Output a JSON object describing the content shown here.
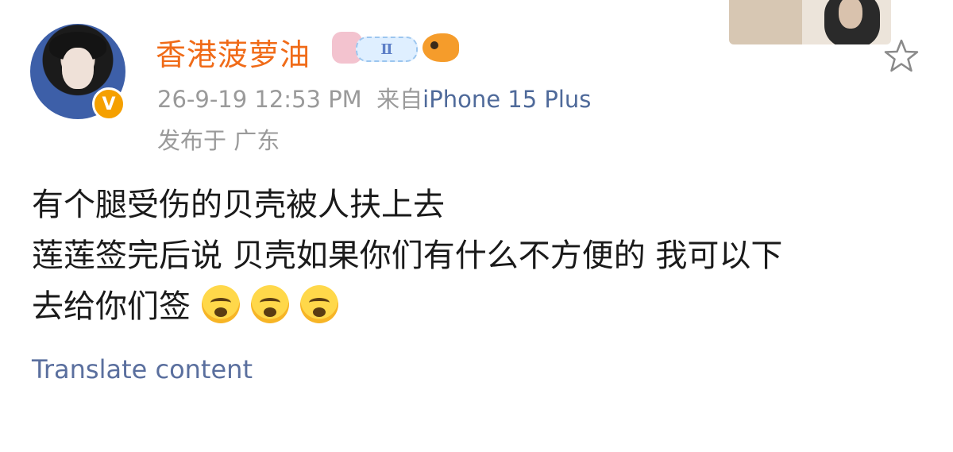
{
  "post": {
    "author": {
      "name": "香港菠萝油",
      "verified_badge": "V",
      "badges": {
        "rank_text": "Ⅱ"
      }
    },
    "timestamp": "26-9-19 12:53 PM",
    "source_prefix": "来自",
    "source_device": "iPhone 15 Plus",
    "location_text": "发布于 广东",
    "content_lines": [
      "有个腿受伤的贝壳被人扶上去",
      "莲莲签完后说 贝壳如果你们有什么不方便的 我可以下",
      "去给你们签"
    ],
    "emoji_count": 3,
    "translate_label": "Translate content"
  },
  "icons": {
    "favorite": "star-outline-icon",
    "cry": "loudly-crying-face-emoji"
  },
  "colors": {
    "username": "#f06b18",
    "meta": "#9a9a9a",
    "device_link": "#4f6a9a",
    "translate_link": "#5a6f9e",
    "verified": "#f5a000"
  }
}
